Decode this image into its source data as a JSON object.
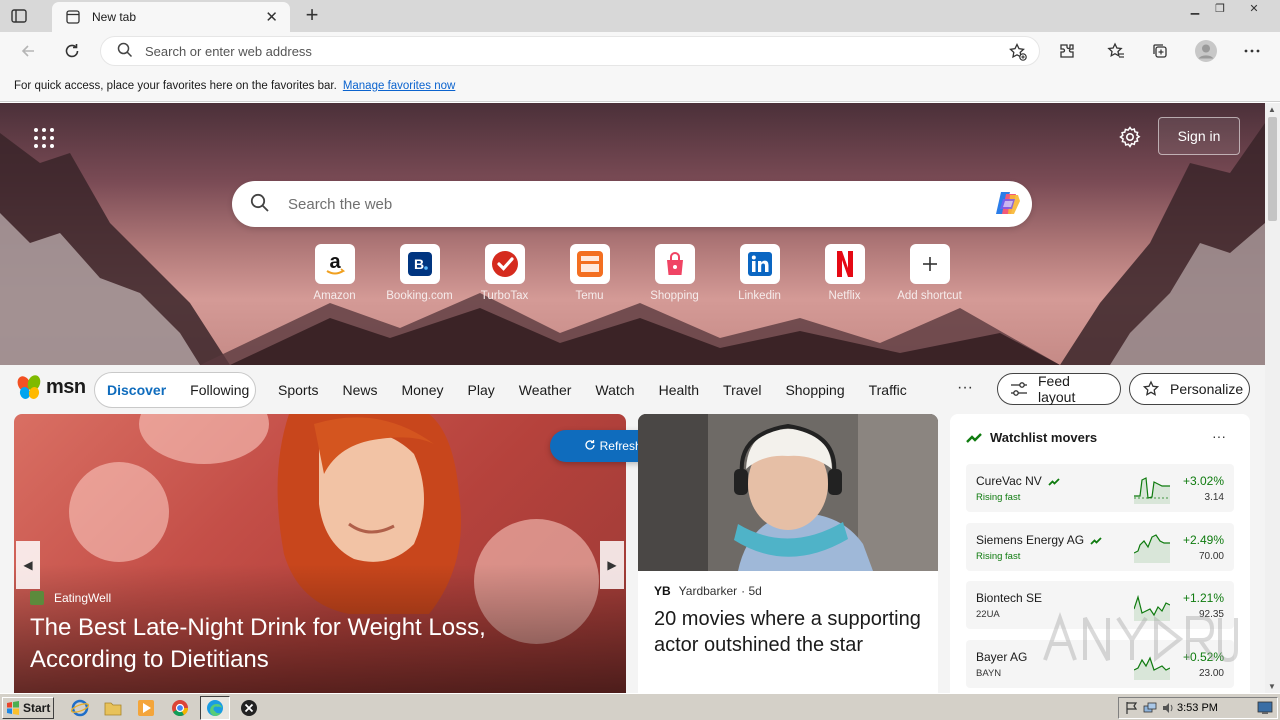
{
  "browser": {
    "tab_title": "New tab",
    "address_placeholder": "Search or enter web address",
    "favbar_text": "For quick access, place your favorites here on the favorites bar.",
    "favbar_link": "Manage favorites now"
  },
  "newtab": {
    "signin_label": "Sign in",
    "search_placeholder": "Search the web",
    "shortcuts": [
      {
        "label": "Amazon",
        "icon": "amazon-icon"
      },
      {
        "label": "Booking.com",
        "icon": "booking-icon"
      },
      {
        "label": "TurboTax",
        "icon": "turbotax-icon"
      },
      {
        "label": "Temu",
        "icon": "temu-icon"
      },
      {
        "label": "Shopping",
        "icon": "shopping-bag-icon"
      },
      {
        "label": "Linkedin",
        "icon": "linkedin-icon"
      },
      {
        "label": "Netflix",
        "icon": "netflix-icon"
      },
      {
        "label": "Add shortcut",
        "icon": "plus-icon"
      }
    ]
  },
  "msn": {
    "logo_text": "msn",
    "segments": [
      "Discover",
      "Following"
    ],
    "nav": [
      "Sports",
      "News",
      "Money",
      "Play",
      "Weather",
      "Watch",
      "Health",
      "Travel",
      "Shopping",
      "Traffic"
    ],
    "more": "···",
    "feed_layout": "Feed layout",
    "personalize": "Personalize",
    "refresh": "Refresh stories"
  },
  "cards": {
    "main": {
      "source": "EatingWell",
      "headline": "The Best Late-Night Drink for Weight Loss, According to Dietitians"
    },
    "second": {
      "source": "Yardbarker",
      "age": "· 5d",
      "headline": "20 movies where a supporting actor outshined the star"
    }
  },
  "watchlist": {
    "title": "Watchlist movers",
    "more": "···",
    "items": [
      {
        "name": "CureVac NV",
        "sub": "Rising fast",
        "change": "+3.02%",
        "price": "3.14",
        "rising": true
      },
      {
        "name": "Siemens Energy AG",
        "sub": "Rising fast",
        "change": "+2.49%",
        "price": "70.00",
        "rising": true
      },
      {
        "name": "Biontech SE",
        "sub": "22UA",
        "change": "+1.21%",
        "price": "92.35",
        "rising": false
      },
      {
        "name": "Bayer AG",
        "sub": "BAYN",
        "change": "+0.52%",
        "price": "23.00",
        "rising": false
      }
    ]
  },
  "taskbar": {
    "start": "Start",
    "time": "3:53 PM"
  },
  "colors": {
    "accent": "#0f6cbd",
    "positive": "#0f7b0f"
  }
}
